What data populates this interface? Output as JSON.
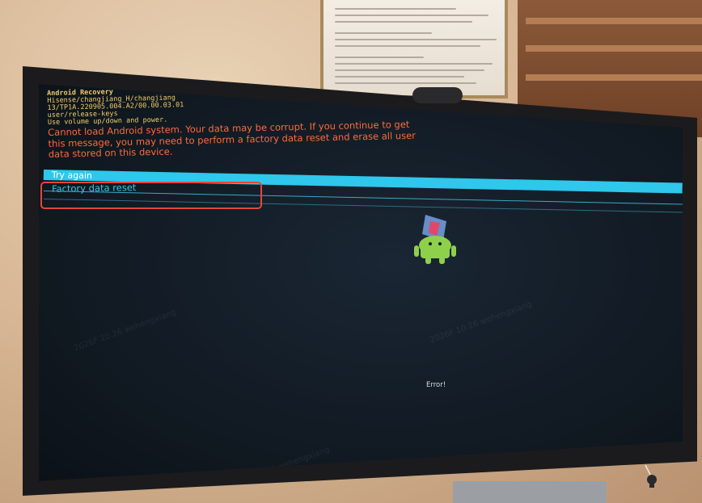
{
  "recovery": {
    "title": "Android Recovery",
    "device": "Hisense/changjiang_H/changjiang",
    "build": "13/TP1A.220905.004.A2/00.00.03.01",
    "keys": "user/release-keys",
    "instructions": "Use volume up/down and power.",
    "error_message": [
      "Cannot load Android system. Your data may be corrupt. If you continue to get",
      "this message, you may need to perform a factory data reset and erase all user",
      "data stored on this device."
    ],
    "menu": [
      {
        "label": "Try again",
        "selected": true
      },
      {
        "label": "Factory data reset",
        "selected": false
      }
    ],
    "status": "Error!"
  },
  "colors": {
    "header_text": "#f0ca6a",
    "error_text": "#ff6a3a",
    "selection_bar": "#2fc7ec",
    "highlight_box": "#e5463a"
  },
  "icons": [
    "android-robot-icon",
    "key-icon"
  ]
}
